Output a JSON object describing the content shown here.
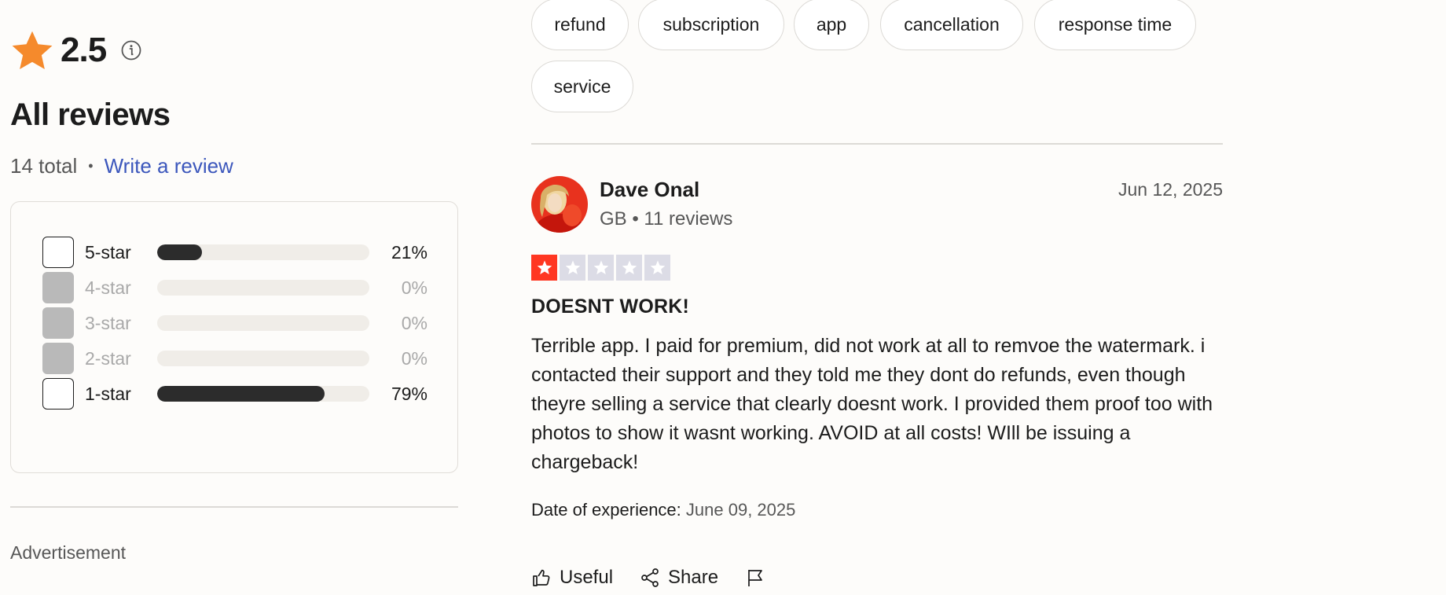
{
  "summary": {
    "score": "2.5",
    "title": "All reviews",
    "total": "14 total",
    "separator": "•",
    "write_review": "Write a review",
    "star_color": "#f58a2c"
  },
  "filters": [
    {
      "label": "5-star",
      "percent": "21%",
      "value": 0.21,
      "disabled": false
    },
    {
      "label": "4-star",
      "percent": "0%",
      "value": 0,
      "disabled": true
    },
    {
      "label": "3-star",
      "percent": "0%",
      "value": 0,
      "disabled": true
    },
    {
      "label": "2-star",
      "percent": "0%",
      "value": 0,
      "disabled": true
    },
    {
      "label": "1-star",
      "percent": "79%",
      "value": 0.79,
      "disabled": false
    }
  ],
  "advertisement": "Advertisement",
  "tags": [
    "refund",
    "subscription",
    "app",
    "cancellation",
    "response time",
    "service"
  ],
  "review": {
    "name": "Dave Onal",
    "meta": "GB • 11 reviews",
    "date": "Jun 12, 2025",
    "rating": 1,
    "rating_color": "#ff3722",
    "title": "DOESNT WORK!",
    "body": "Terrible app. I paid for premium, did not work at all to remvoe the watermark. i contacted their support and they told me they dont do refunds, even though theyre selling a service that clearly doesnt work. I provided them proof too with photos to show it wasnt working. AVOID at all costs! WIll be issuing a chargeback!",
    "experience_label": "Date of experience:",
    "experience_date": "June 09, 2025"
  },
  "actions": {
    "useful": "Useful",
    "share": "Share"
  }
}
